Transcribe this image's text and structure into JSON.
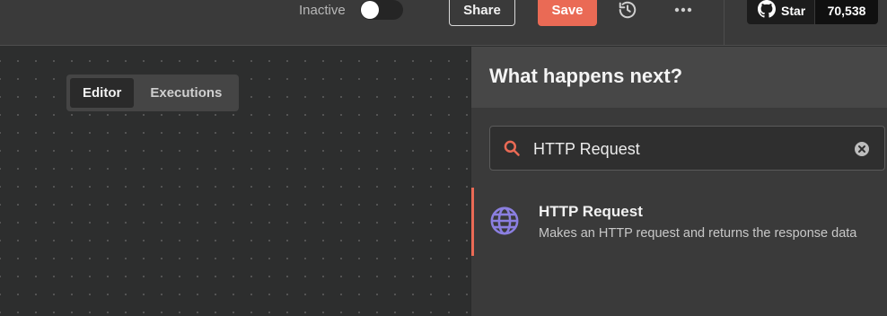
{
  "header": {
    "toggle_label": "Inactive",
    "toggle_state": "off",
    "share_label": "Share",
    "save_label": "Save",
    "history_icon": "history-icon",
    "more_icon": "more-horizontal-icon",
    "github": {
      "icon": "github-icon",
      "star_label": "Star",
      "star_count": "70,538"
    }
  },
  "canvas": {
    "tabs": [
      {
        "label": "Editor",
        "active": true
      },
      {
        "label": "Executions",
        "active": false
      }
    ]
  },
  "panel": {
    "title": "What happens next?",
    "search": {
      "value": "HTTP Request",
      "icon": "search-icon",
      "clear_icon": "clear-icon"
    },
    "results": [
      {
        "icon": "globe-icon",
        "title": "HTTP Request",
        "description": "Makes an HTTP request and returns the response data"
      }
    ]
  },
  "colors": {
    "accent": "#ea6a55",
    "globe": "#8b7fe0",
    "background": "#2d2e2e"
  }
}
